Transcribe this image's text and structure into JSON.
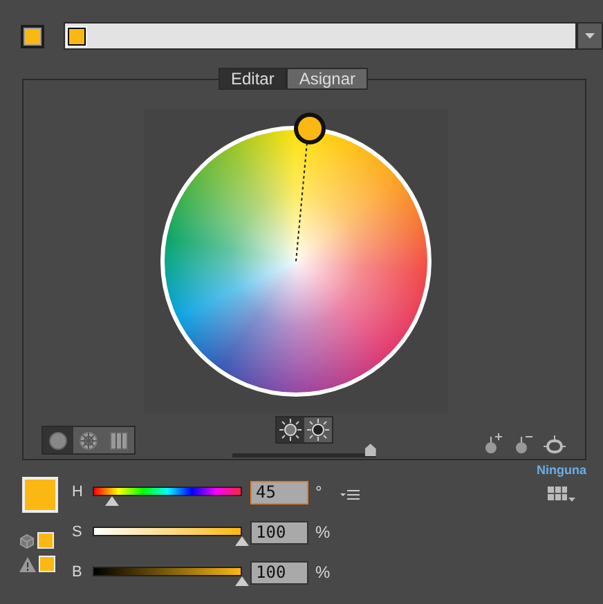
{
  "tabs": [
    {
      "label": "Editar",
      "selected": true
    },
    {
      "label": "Asignar",
      "selected": false
    }
  ],
  "view_modes": [
    {
      "kind": "smooth",
      "selected": true
    },
    {
      "kind": "segmented",
      "selected": false
    },
    {
      "kind": "bars",
      "selected": false
    }
  ],
  "wheel_modes": [
    {
      "kind": "brightness",
      "selected": true
    },
    {
      "kind": "saturation",
      "selected": false
    }
  ],
  "wheel_slider": {
    "level": 0.96
  },
  "sliders": [
    {
      "label": "H",
      "kind": "hue",
      "level": 0.125,
      "value": "45",
      "unit": "°",
      "focused": true
    },
    {
      "label": "S",
      "kind": "saturation",
      "level": 1,
      "value": "100",
      "unit": "%",
      "focused": false
    },
    {
      "label": "B",
      "kind": "brightness",
      "level": 1,
      "value": "100",
      "unit": "%",
      "focused": false
    }
  ],
  "color_group": "Ninguna"
}
